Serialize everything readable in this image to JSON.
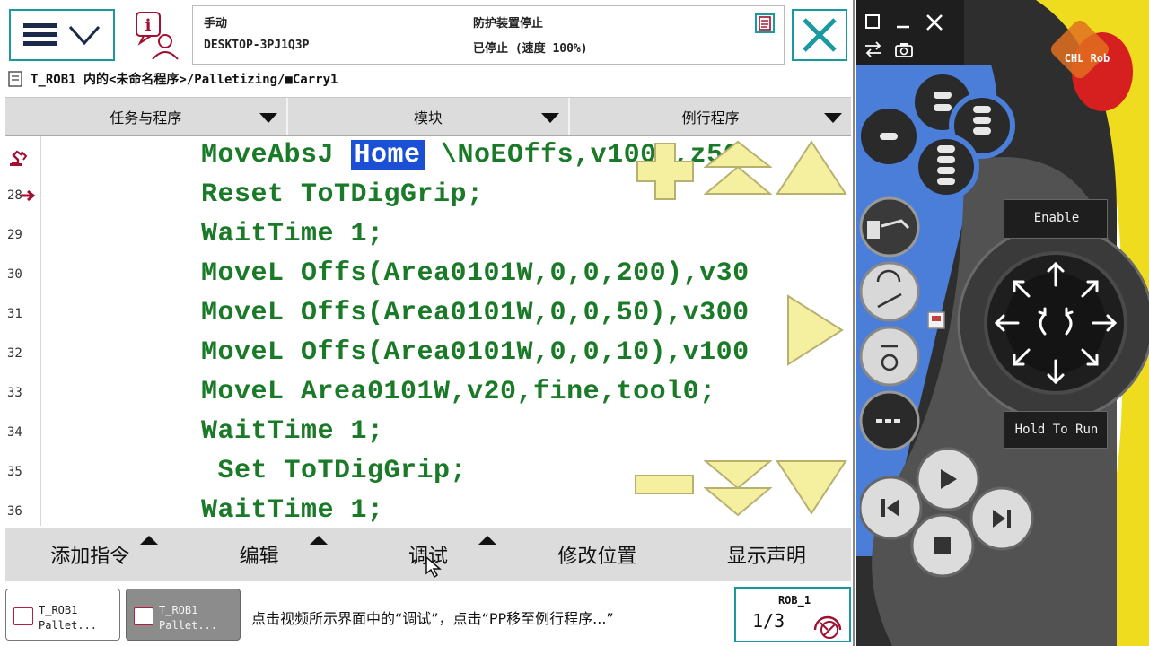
{
  "header": {
    "mode": "手动",
    "controller": "DESKTOP-3PJ1Q3P",
    "safety_state": "防护装置停止",
    "run_state": "已停止 (速度 100%)"
  },
  "breadcrumb": "T_ROB1 内的<未命名程序>/Palletizing/■Carry1",
  "dropdowns": [
    "任务与程序",
    "模块",
    "例行程序"
  ],
  "code_lines": [
    {
      "num": "",
      "marker": "robot-icon",
      "code": "MoveAbsJ ",
      "hl": "Home",
      "rest": " \\NoEOffs,v1000,z50,"
    },
    {
      "num": "28",
      "marker": "program-pointer",
      "code": "Reset ToTDigGrip;"
    },
    {
      "num": "29",
      "code": "WaitTime 1;"
    },
    {
      "num": "30",
      "code": "MoveL Offs(Area0101W,0,0,200),v30"
    },
    {
      "num": "31",
      "code": "MoveL Offs(Area0101W,0,0,50),v300"
    },
    {
      "num": "32",
      "code": "MoveL Offs(Area0101W,0,0,10),v100"
    },
    {
      "num": "33",
      "code": "MoveL Area0101W,v20,fine,tool0;"
    },
    {
      "num": "34",
      "code": "WaitTime 1;"
    },
    {
      "num": "35",
      "code": " Set ToTDigGrip;"
    },
    {
      "num": "36",
      "code": "WaitTime 1;"
    }
  ],
  "bottom_menu": [
    {
      "label": "添加指令",
      "has_arrow": true
    },
    {
      "label": "编辑",
      "has_arrow": true
    },
    {
      "label": "调试",
      "has_arrow": true
    },
    {
      "label": "修改位置",
      "has_arrow": false
    },
    {
      "label": "显示声明",
      "has_arrow": false
    }
  ],
  "taskbar": {
    "tab1": {
      "line1": "T_ROB1",
      "line2": "Pallet..."
    },
    "tab2": {
      "line1": "T_ROB1",
      "line2": "Pallet..."
    },
    "caption": "点击视频所示界面中的“调试”，点击“PP移至例行程序...”",
    "robot": {
      "name": "ROB_1",
      "fraction": "1/3"
    }
  },
  "pendant": {
    "logo": "CHL Rob",
    "enable_label": "Enable",
    "hold_label": "Hold To Run"
  },
  "colors": {
    "code_green": "#1a7a28",
    "highlight_blue": "#1a4fd6",
    "frame_teal": "#1a9aa0",
    "overlay_yellow": "#f5f0a0",
    "pendant_yellow": "#f0dc1e",
    "pendant_blue": "#4a7ed8",
    "pendant_dark": "#2e2e2e"
  }
}
